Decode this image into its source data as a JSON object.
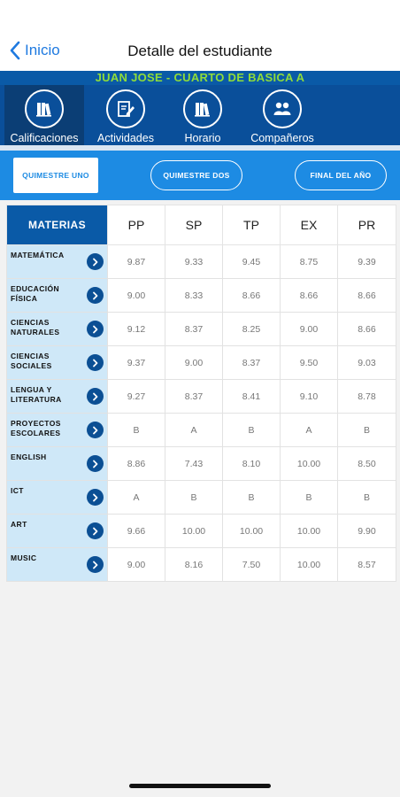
{
  "navbar": {
    "back_label": "Inicio",
    "title": "Detalle del estudiante"
  },
  "student": {
    "info": "JUAN JOSE - CUARTO DE BASICA A"
  },
  "tabs": [
    {
      "label": "Calificaciones",
      "icon": "books-icon",
      "active": true
    },
    {
      "label": "Actividades",
      "icon": "edit-icon",
      "active": false
    },
    {
      "label": "Horario",
      "icon": "books-icon",
      "active": false
    },
    {
      "label": "Compañeros",
      "icon": "people-icon",
      "active": false
    }
  ],
  "periods": [
    {
      "label": "QUIMESTRE UNO",
      "active": true
    },
    {
      "label": "QUIMESTRE DOS",
      "active": false
    },
    {
      "label": "FINAL DEL AÑO",
      "active": false
    }
  ],
  "table": {
    "headers": [
      "MATERIAS",
      "PP",
      "SP",
      "TP",
      "EX",
      "PR"
    ],
    "rows": [
      {
        "subject": "MATEMÁTICA",
        "grades": [
          "9.87",
          "9.33",
          "9.45",
          "8.75",
          "9.39"
        ]
      },
      {
        "subject": "EDUCACIÓN FÍSICA",
        "grades": [
          "9.00",
          "8.33",
          "8.66",
          "8.66",
          "8.66"
        ]
      },
      {
        "subject": "CIENCIAS NATURALES",
        "grades": [
          "9.12",
          "8.37",
          "8.25",
          "9.00",
          "8.66"
        ]
      },
      {
        "subject": "CIENCIAS SOCIALES",
        "grades": [
          "9.37",
          "9.00",
          "8.37",
          "9.50",
          "9.03"
        ]
      },
      {
        "subject": "LENGUA Y LITERATURA",
        "grades": [
          "9.27",
          "8.37",
          "8.41",
          "9.10",
          "8.78"
        ]
      },
      {
        "subject": "PROYECTOS ESCOLARES",
        "grades": [
          "B",
          "A",
          "B",
          "A",
          "B"
        ]
      },
      {
        "subject": "ENGLISH",
        "grades": [
          "8.86",
          "7.43",
          "8.10",
          "10.00",
          "8.50"
        ]
      },
      {
        "subject": "ICT",
        "grades": [
          "A",
          "B",
          "B",
          "B",
          "B"
        ]
      },
      {
        "subject": "ART",
        "grades": [
          "9.66",
          "10.00",
          "10.00",
          "10.00",
          "9.90"
        ]
      },
      {
        "subject": "MUSIC",
        "grades": [
          "9.00",
          "8.16",
          "7.50",
          "10.00",
          "8.57"
        ]
      }
    ]
  },
  "colors": {
    "primary": "#0a5aa7",
    "tabbar": "#0a4f9a",
    "period_bar": "#1d8be3",
    "student_text": "#8fdc3a",
    "subject_bg": "#cfe8f8"
  }
}
